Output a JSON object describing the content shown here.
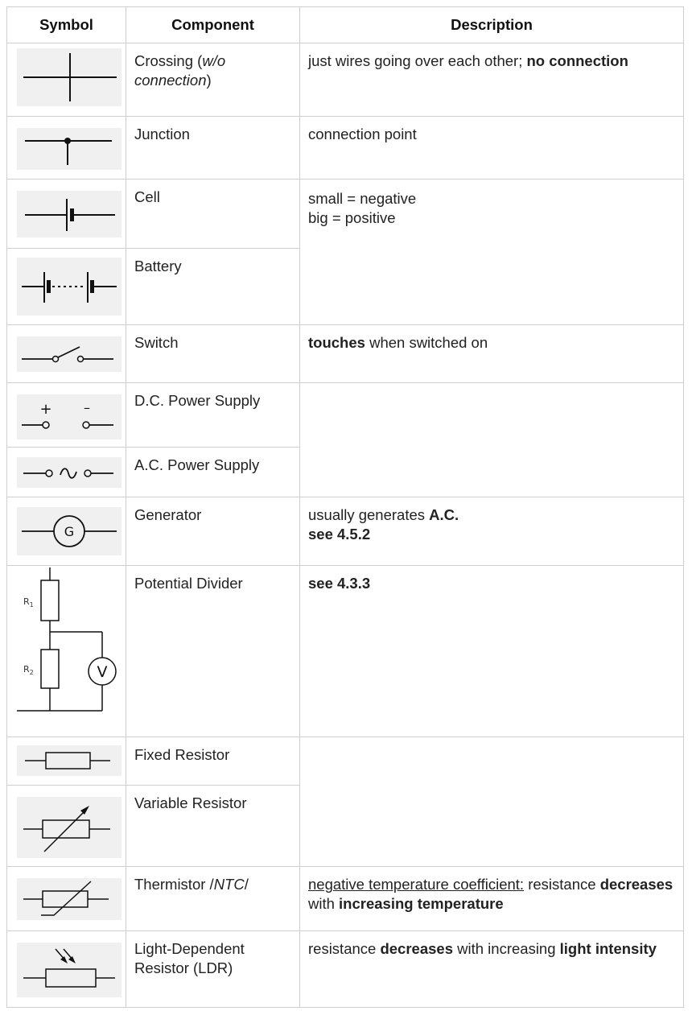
{
  "header": {
    "symbol": "Symbol",
    "component": "Component",
    "description": "Description"
  },
  "rows": {
    "crossing": {
      "name_a": "Crossing (",
      "name_i": "w/o connection",
      "name_b": ")",
      "desc_a": "just wires going over each other; ",
      "desc_b": "no connection",
      "icon": "crossing-wires-icon"
    },
    "junction": {
      "name": "Junction",
      "desc": "connection point",
      "icon": "junction-icon"
    },
    "cell": {
      "name": "Cell",
      "desc_1": "small = negative",
      "desc_2": "big = positive",
      "icon": "cell-icon"
    },
    "battery": {
      "name": "Battery",
      "icon": "battery-icon"
    },
    "switch": {
      "name": "Switch",
      "desc_b": "touches",
      "desc_a": " when switched on",
      "icon": "switch-icon"
    },
    "dc": {
      "name": "D.C. Power Supply",
      "plus": "+",
      "minus": "–",
      "icon": "dc-supply-icon"
    },
    "ac": {
      "name": "A.C. Power Supply",
      "icon": "ac-supply-icon"
    },
    "generator": {
      "name": "Generator",
      "letter": "G",
      "desc_a": "usually generates ",
      "desc_b": "A.C.",
      "desc_c": "see 4.5.2",
      "icon": "generator-icon"
    },
    "divider": {
      "name": "Potential Divider",
      "desc": "see 4.3.3",
      "r1": "R",
      "r1_sub": "1",
      "r2": "R",
      "r2_sub": "2",
      "v": "V",
      "icon": "potential-divider-icon"
    },
    "fixed": {
      "name": "Fixed Resistor",
      "icon": "fixed-resistor-icon"
    },
    "variable": {
      "name": "Variable Resistor",
      "icon": "variable-resistor-icon"
    },
    "thermistor": {
      "name_a": "Thermistor /",
      "name_i": "NTC",
      "name_b": "/",
      "desc_u": "negative temperature coefficient:",
      "desc_a": " resistance ",
      "desc_b1": "decreases",
      "desc_c": " with ",
      "desc_b2": "increasing temperature",
      "icon": "thermistor-icon"
    },
    "ldr": {
      "name": "Light-Dependent Resistor (LDR)",
      "desc_a": "resistance ",
      "desc_b1": "decreases",
      "desc_c": " with increasing ",
      "desc_b2": "light intensity",
      "icon": "ldr-icon"
    }
  }
}
